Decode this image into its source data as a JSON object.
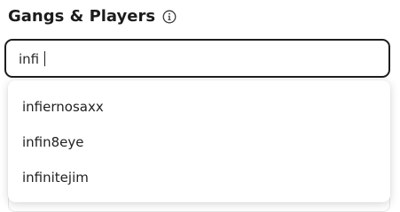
{
  "header": {
    "title": "Gangs & Players",
    "info_icon": "info-icon"
  },
  "search": {
    "value": "infi"
  },
  "dropdown": {
    "options": [
      {
        "label": "infiernosaxx"
      },
      {
        "label": "infin8eye"
      },
      {
        "label": "infinitejim"
      }
    ]
  },
  "colors": {
    "border": "#1e1e1e",
    "text": "#1c1c1c"
  }
}
